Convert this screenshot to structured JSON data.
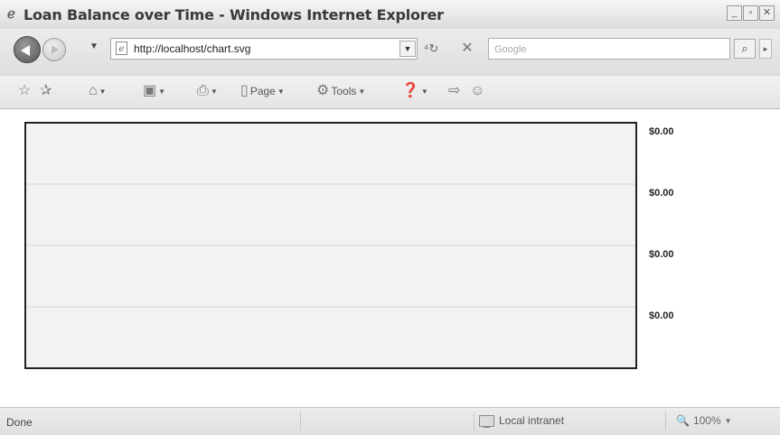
{
  "window": {
    "title": "Loan Balance over Time - Windows Internet Explorer",
    "controls": [
      "_",
      "▫",
      "✕"
    ]
  },
  "address_bar": {
    "url": "http://localhost/chart.svg",
    "search_placeholder": "Google"
  },
  "command_bar": {
    "page_label": "Page",
    "tools_label": "Tools"
  },
  "chart_data": {
    "type": "line",
    "title": "",
    "y_tick_labels": [
      "$0.00",
      "$0.00",
      "$0.00",
      "$0.00"
    ],
    "series": [],
    "grid": true,
    "plot_background": "#f2f2f2",
    "frame_color": "#222222",
    "grid_color": "#d8d8c8"
  },
  "status_bar": {
    "status_text": "Done",
    "zone_label": "Local intranet",
    "zoom_label": "100%"
  }
}
